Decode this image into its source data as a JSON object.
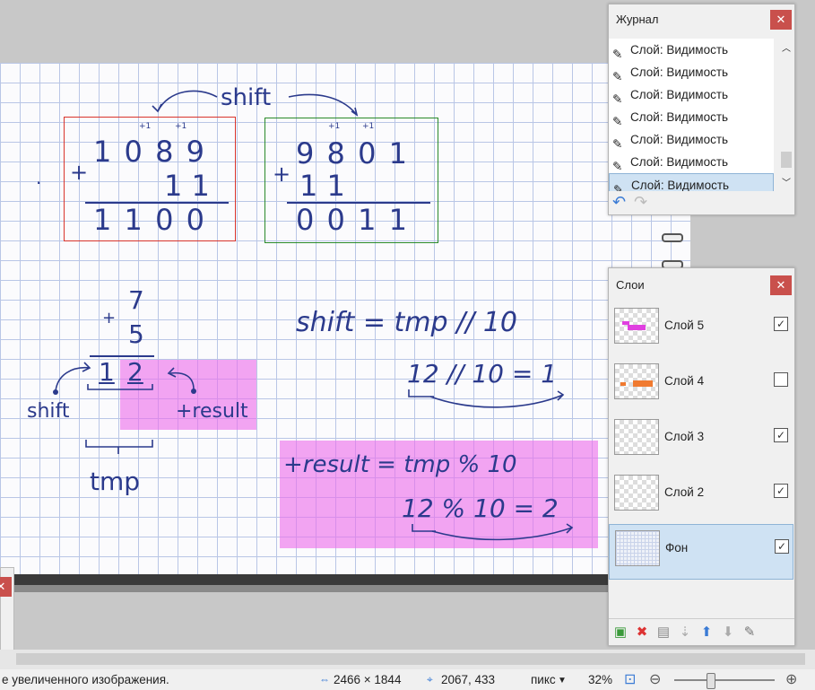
{
  "canvas": {
    "shift_label_top": "shift",
    "left_sum": {
      "top": "1 0 8 9",
      "plus": "+",
      "mid": "1 1",
      "result": "1 1 0 0",
      "carry1": "+1",
      "carry2": "+1",
      "dot": "."
    },
    "right_sum": {
      "top": "9 8 0 1",
      "plus": "+",
      "mid": "1 1",
      "result": "0 0 1 1",
      "carry1": "+1",
      "carry2": "+1"
    },
    "small_sum": {
      "plus": "+",
      "n1": "7",
      "n2": "5",
      "res1": "1",
      "res2": "2"
    },
    "label_shift": "shift",
    "label_result": "+result",
    "label_tmp": "tmp",
    "eq1": "shift = tmp // 10",
    "eq1_example": "12 // 10 = 1",
    "eq2": "+result = tmp % 10",
    "eq2_example": "12 % 10 = 2"
  },
  "history": {
    "title": "Журнал",
    "close": "✕",
    "items": [
      "Слой: Видимость",
      "Слой: Видимость",
      "Слой: Видимость",
      "Слой: Видимость",
      "Слой: Видимость",
      "Слой: Видимость",
      "Слой: Видимость"
    ],
    "undo": "↶",
    "redo": "↷"
  },
  "layers": {
    "title": "Слои",
    "close": "✕",
    "items": [
      {
        "name": "Слой 5",
        "visible": true,
        "check": "✓"
      },
      {
        "name": "Слой 4",
        "visible": false,
        "check": ""
      },
      {
        "name": "Слой 3",
        "visible": true,
        "check": "✓"
      },
      {
        "name": "Слой 2",
        "visible": true,
        "check": "✓"
      },
      {
        "name": "Фон",
        "visible": true,
        "check": "✓"
      }
    ],
    "toolbar": [
      "add-layer",
      "delete-layer",
      "duplicate-layer",
      "merge-layer-down",
      "move-layer-up",
      "move-layer-down",
      "layer-properties"
    ]
  },
  "left_panel": {
    "close": "✕"
  },
  "status": {
    "hint": "е увеличенного изображения.",
    "image_size": "2466 × 1844",
    "cursor_pos": "2067, 433",
    "units": "пикс",
    "zoom": "32%"
  },
  "colors": {
    "highlight": "#eb6eeb",
    "red_box": "#d9342b",
    "green_box": "#2a8a2a",
    "ink": "#2b3a8c",
    "close": "#c9504c"
  }
}
